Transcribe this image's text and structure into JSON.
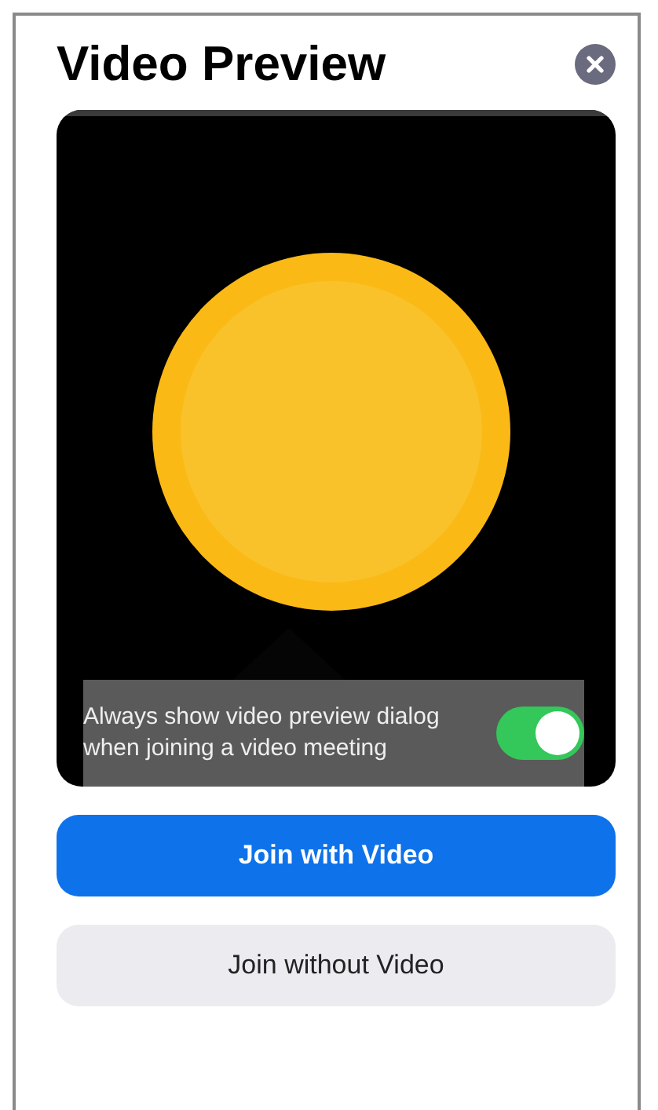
{
  "title": "Video Preview",
  "preview_setting": {
    "label": "Always show video preview dialog when joining a video meeting",
    "on": true
  },
  "buttons": [
    {
      "label": "Join with Video",
      "kind": "primary"
    },
    {
      "label": "Join without Video",
      "kind": "secondary"
    }
  ]
}
